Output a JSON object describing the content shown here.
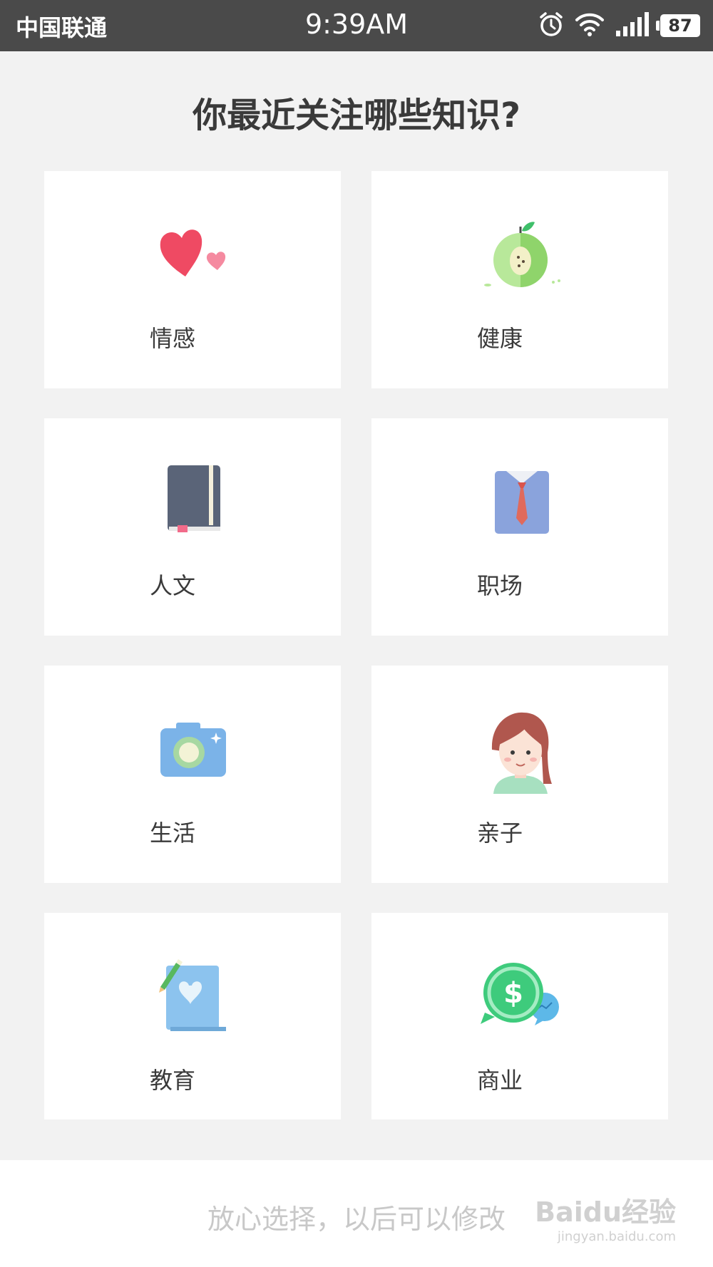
{
  "status_bar": {
    "carrier": "中国联通",
    "time": "9:39AM",
    "battery_level": "87",
    "icons": [
      "alarm-icon",
      "wifi-icon",
      "signal-icon",
      "battery-icon"
    ]
  },
  "page": {
    "title": "你最近关注哪些知识?"
  },
  "categories": [
    {
      "label": "情感",
      "icon": "hearts-icon"
    },
    {
      "label": "健康",
      "icon": "apple-icon"
    },
    {
      "label": "人文",
      "icon": "book-icon"
    },
    {
      "label": "职场",
      "icon": "shirt-tie-icon"
    },
    {
      "label": "生活",
      "icon": "camera-icon"
    },
    {
      "label": "亲子",
      "icon": "girl-avatar-icon"
    },
    {
      "label": "教育",
      "icon": "notepad-pencil-icon"
    },
    {
      "label": "商业",
      "icon": "dollar-coin-icon"
    }
  ],
  "footer": {
    "hint": "放心选择，以后可以修改",
    "watermark_main": "Baidu经验",
    "watermark_sub": "jingyan.baidu.com"
  },
  "colors": {
    "status_bar": "#4a4a4a",
    "background": "#f2f2f2",
    "card": "#ffffff",
    "hint_text": "#c8c8c8"
  }
}
